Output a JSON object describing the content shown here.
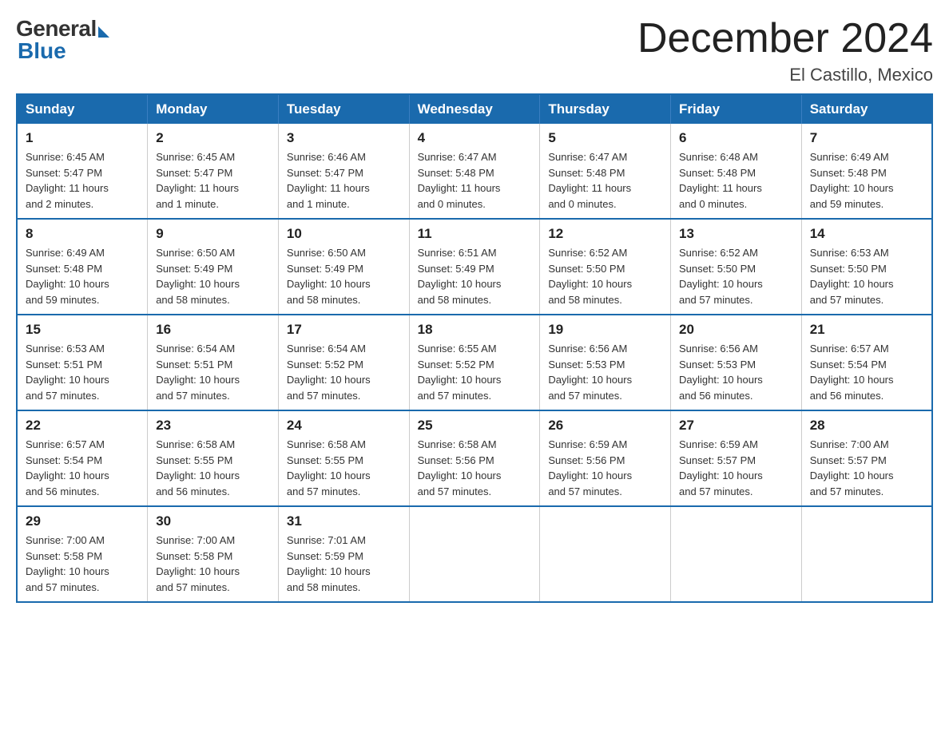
{
  "logo": {
    "general": "General",
    "blue": "Blue"
  },
  "title": "December 2024",
  "location": "El Castillo, Mexico",
  "days_of_week": [
    "Sunday",
    "Monday",
    "Tuesday",
    "Wednesday",
    "Thursday",
    "Friday",
    "Saturday"
  ],
  "weeks": [
    [
      {
        "day": "1",
        "info": "Sunrise: 6:45 AM\nSunset: 5:47 PM\nDaylight: 11 hours\nand 2 minutes."
      },
      {
        "day": "2",
        "info": "Sunrise: 6:45 AM\nSunset: 5:47 PM\nDaylight: 11 hours\nand 1 minute."
      },
      {
        "day": "3",
        "info": "Sunrise: 6:46 AM\nSunset: 5:47 PM\nDaylight: 11 hours\nand 1 minute."
      },
      {
        "day": "4",
        "info": "Sunrise: 6:47 AM\nSunset: 5:48 PM\nDaylight: 11 hours\nand 0 minutes."
      },
      {
        "day": "5",
        "info": "Sunrise: 6:47 AM\nSunset: 5:48 PM\nDaylight: 11 hours\nand 0 minutes."
      },
      {
        "day": "6",
        "info": "Sunrise: 6:48 AM\nSunset: 5:48 PM\nDaylight: 11 hours\nand 0 minutes."
      },
      {
        "day": "7",
        "info": "Sunrise: 6:49 AM\nSunset: 5:48 PM\nDaylight: 10 hours\nand 59 minutes."
      }
    ],
    [
      {
        "day": "8",
        "info": "Sunrise: 6:49 AM\nSunset: 5:48 PM\nDaylight: 10 hours\nand 59 minutes."
      },
      {
        "day": "9",
        "info": "Sunrise: 6:50 AM\nSunset: 5:49 PM\nDaylight: 10 hours\nand 58 minutes."
      },
      {
        "day": "10",
        "info": "Sunrise: 6:50 AM\nSunset: 5:49 PM\nDaylight: 10 hours\nand 58 minutes."
      },
      {
        "day": "11",
        "info": "Sunrise: 6:51 AM\nSunset: 5:49 PM\nDaylight: 10 hours\nand 58 minutes."
      },
      {
        "day": "12",
        "info": "Sunrise: 6:52 AM\nSunset: 5:50 PM\nDaylight: 10 hours\nand 58 minutes."
      },
      {
        "day": "13",
        "info": "Sunrise: 6:52 AM\nSunset: 5:50 PM\nDaylight: 10 hours\nand 57 minutes."
      },
      {
        "day": "14",
        "info": "Sunrise: 6:53 AM\nSunset: 5:50 PM\nDaylight: 10 hours\nand 57 minutes."
      }
    ],
    [
      {
        "day": "15",
        "info": "Sunrise: 6:53 AM\nSunset: 5:51 PM\nDaylight: 10 hours\nand 57 minutes."
      },
      {
        "day": "16",
        "info": "Sunrise: 6:54 AM\nSunset: 5:51 PM\nDaylight: 10 hours\nand 57 minutes."
      },
      {
        "day": "17",
        "info": "Sunrise: 6:54 AM\nSunset: 5:52 PM\nDaylight: 10 hours\nand 57 minutes."
      },
      {
        "day": "18",
        "info": "Sunrise: 6:55 AM\nSunset: 5:52 PM\nDaylight: 10 hours\nand 57 minutes."
      },
      {
        "day": "19",
        "info": "Sunrise: 6:56 AM\nSunset: 5:53 PM\nDaylight: 10 hours\nand 57 minutes."
      },
      {
        "day": "20",
        "info": "Sunrise: 6:56 AM\nSunset: 5:53 PM\nDaylight: 10 hours\nand 56 minutes."
      },
      {
        "day": "21",
        "info": "Sunrise: 6:57 AM\nSunset: 5:54 PM\nDaylight: 10 hours\nand 56 minutes."
      }
    ],
    [
      {
        "day": "22",
        "info": "Sunrise: 6:57 AM\nSunset: 5:54 PM\nDaylight: 10 hours\nand 56 minutes."
      },
      {
        "day": "23",
        "info": "Sunrise: 6:58 AM\nSunset: 5:55 PM\nDaylight: 10 hours\nand 56 minutes."
      },
      {
        "day": "24",
        "info": "Sunrise: 6:58 AM\nSunset: 5:55 PM\nDaylight: 10 hours\nand 57 minutes."
      },
      {
        "day": "25",
        "info": "Sunrise: 6:58 AM\nSunset: 5:56 PM\nDaylight: 10 hours\nand 57 minutes."
      },
      {
        "day": "26",
        "info": "Sunrise: 6:59 AM\nSunset: 5:56 PM\nDaylight: 10 hours\nand 57 minutes."
      },
      {
        "day": "27",
        "info": "Sunrise: 6:59 AM\nSunset: 5:57 PM\nDaylight: 10 hours\nand 57 minutes."
      },
      {
        "day": "28",
        "info": "Sunrise: 7:00 AM\nSunset: 5:57 PM\nDaylight: 10 hours\nand 57 minutes."
      }
    ],
    [
      {
        "day": "29",
        "info": "Sunrise: 7:00 AM\nSunset: 5:58 PM\nDaylight: 10 hours\nand 57 minutes."
      },
      {
        "day": "30",
        "info": "Sunrise: 7:00 AM\nSunset: 5:58 PM\nDaylight: 10 hours\nand 57 minutes."
      },
      {
        "day": "31",
        "info": "Sunrise: 7:01 AM\nSunset: 5:59 PM\nDaylight: 10 hours\nand 58 minutes."
      },
      null,
      null,
      null,
      null
    ]
  ]
}
